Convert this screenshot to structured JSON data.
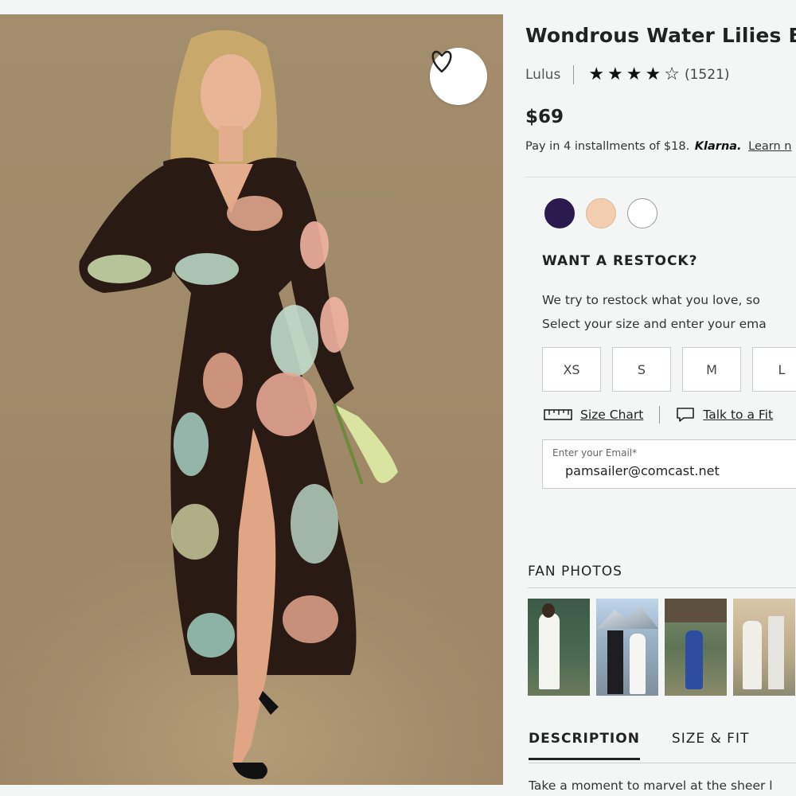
{
  "product": {
    "title": "Wondrous Water Lilies Bla",
    "brand": "Lulus",
    "rating_stars": 4.5,
    "review_count": "(1521)",
    "price": "$69",
    "installments_text": "Pay in 4 installments of $18.",
    "klarna_label": "Klarna.",
    "learn_more": "Learn n"
  },
  "colors": {
    "swatches": [
      "#2b1a4e",
      "#f2cdb0",
      "#ffffff"
    ]
  },
  "restock": {
    "heading": "WANT A RESTOCK?",
    "line1": "We try to restock what you love, so",
    "line2": "Select your size and enter your ema"
  },
  "sizes": [
    "XS",
    "S",
    "M",
    "L"
  ],
  "help": {
    "size_chart": "Size Chart",
    "talk_to_fit": "Talk to a Fit"
  },
  "email": {
    "label": "Enter your Email*",
    "value": "pamsailer@comcast.net"
  },
  "fan_photos": {
    "heading": "FAN PHOTOS"
  },
  "tabs": {
    "description": "DESCRIPTION",
    "size_fit": "SIZE & FIT"
  },
  "description_text": "Take a moment to marvel at the sheer l"
}
